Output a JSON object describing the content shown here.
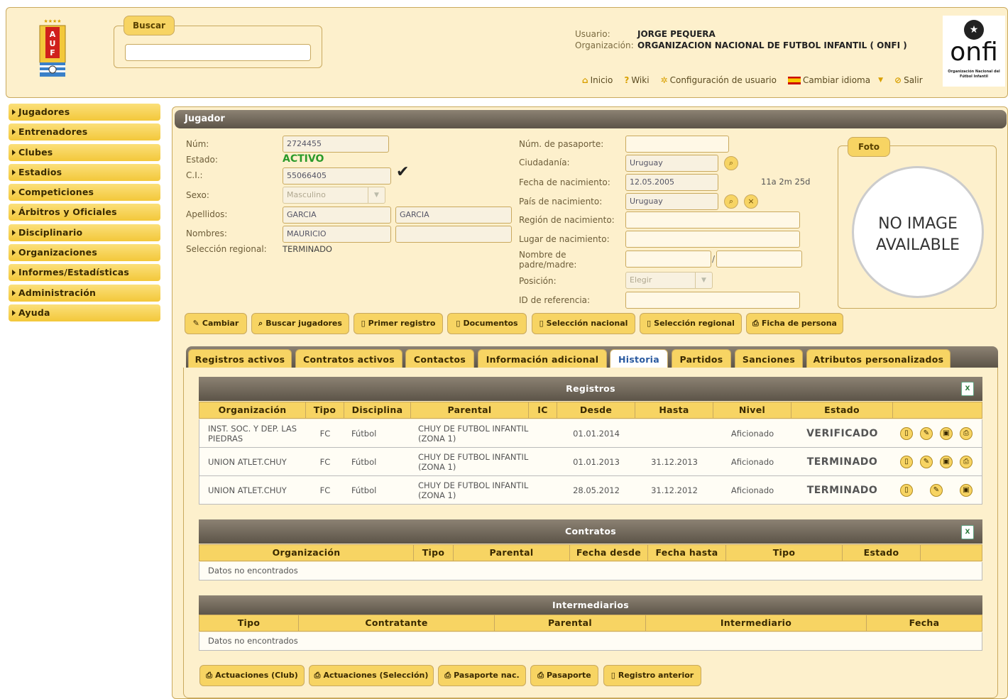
{
  "header": {
    "search_label": "Buscar",
    "search_value": "",
    "user_label": "Usuario:",
    "user_value": "JORGE PEQUERA",
    "org_label": "Organización:",
    "org_value": "ORGANIZACION NACIONAL DE FUTBOL INFANTIL ( ONFI )",
    "links": [
      "Inicio",
      "Wiki",
      "Configuración de usuario",
      "Cambiar idioma",
      "Salir"
    ],
    "auf_logo_text": "AUF",
    "onfi_logo_text": "onfi",
    "onfi_logo_sub": "Organización Nacional del Fútbol Infantil"
  },
  "sidebar": {
    "items": [
      "Jugadores",
      "Entrenadores",
      "Clubes",
      "Estadios",
      "Competiciones",
      "Árbitros y Oficiales",
      "Disciplinario",
      "Organizaciones",
      "Informes/Estadísticas",
      "Administración",
      "Ayuda"
    ]
  },
  "player": {
    "section_title": "Jugador",
    "num_label": "Núm:",
    "num_value": "2724455",
    "estado_label": "Estado:",
    "estado_value": "ACTIVO",
    "ci_label": "C.I.:",
    "ci_value": "55066405",
    "sexo_label": "Sexo:",
    "sexo_value": "Masculino",
    "apellidos_label": "Apellidos:",
    "apellido1": "GARCIA",
    "apellido2": "GARCIA",
    "nombres_label": "Nombres:",
    "nombre1": "MAURICIO",
    "nombre2": "",
    "seleccion_label": "Selección regional:",
    "seleccion_value": "TERMINADO",
    "pasaporte_label": "Núm. de pasaporte:",
    "pasaporte_value": "",
    "ciudadania_label": "Ciudadanía:",
    "ciudadania_value": "Uruguay",
    "fecha_nac_label": "Fecha de nacimiento:",
    "fecha_nac_value": "12.05.2005",
    "edad": "11a 2m 25d",
    "pais_nac_label": "País de nacimiento:",
    "pais_nac_value": "Uruguay",
    "region_label": "Región de nacimiento:",
    "lugar_label": "Lugar de nacimiento:",
    "padre_label": "Nombre de padre/madre:",
    "padre_sep": "/",
    "posicion_label": "Posición:",
    "posicion_value": "Elegir",
    "idref_label": "ID de referencia:",
    "foto_label": "Foto",
    "noimage_line1": "NO IMAGE",
    "noimage_line2": "AVAILABLE"
  },
  "actions": [
    "Cambiar",
    "Buscar jugadores",
    "Primer registro",
    "Documentos",
    "Selección nacional",
    "Selección regional",
    "Ficha de persona"
  ],
  "tabs": [
    "Registros activos",
    "Contratos activos",
    "Contactos",
    "Información adicional",
    "Historia",
    "Partidos",
    "Sanciones",
    "Atributos personalizados"
  ],
  "registros": {
    "title": "Registros",
    "columns": [
      "Organización",
      "Tipo",
      "Disciplina",
      "Parental",
      "IC",
      "Desde",
      "Hasta",
      "Nivel",
      "Estado",
      ""
    ],
    "rows": [
      {
        "org": "INST. SOC. Y DEP. LAS PIEDRAS",
        "tipo": "FC",
        "disc": "Fútbol",
        "parental": "CHUY DE FUTBOL INFANTIL (ZONA 1)",
        "ic": "",
        "desde": "01.01.2014",
        "hasta": "",
        "nivel": "Aficionado",
        "estado": "VERIFICADO"
      },
      {
        "org": "UNION ATLET.CHUY",
        "tipo": "FC",
        "disc": "Fútbol",
        "parental": "CHUY DE FUTBOL INFANTIL (ZONA 1)",
        "ic": "",
        "desde": "01.01.2013",
        "hasta": "31.12.2013",
        "nivel": "Aficionado",
        "estado": "TERMINADO"
      },
      {
        "org": "UNION ATLET.CHUY",
        "tipo": "FC",
        "disc": "Fútbol",
        "parental": "CHUY DE FUTBOL INFANTIL (ZONA 1)",
        "ic": "",
        "desde": "28.05.2012",
        "hasta": "31.12.2012",
        "nivel": "Aficionado",
        "estado": "TERMINADO"
      }
    ]
  },
  "contratos": {
    "title": "Contratos",
    "columns": [
      "Organización",
      "Tipo",
      "Parental",
      "Fecha desde",
      "Fecha hasta",
      "Tipo",
      "Estado",
      ""
    ],
    "empty": "Datos no encontrados"
  },
  "intermediarios": {
    "title": "Intermediarios",
    "columns": [
      "Tipo",
      "Contratante",
      "Parental",
      "Intermediario",
      "Fecha"
    ],
    "empty": "Datos no encontrados"
  },
  "bottom_actions": [
    "Actuaciones (Club)",
    "Actuaciones (Selección)",
    "Pasaporte nac.",
    "Pasaporte",
    "Registro anterior"
  ],
  "colors": {
    "accent": "#f7d463",
    "panel": "#fdf0cc",
    "verified": "#1a20c8",
    "terminated": "#7a0a0a",
    "active": "#2a9a2a"
  }
}
